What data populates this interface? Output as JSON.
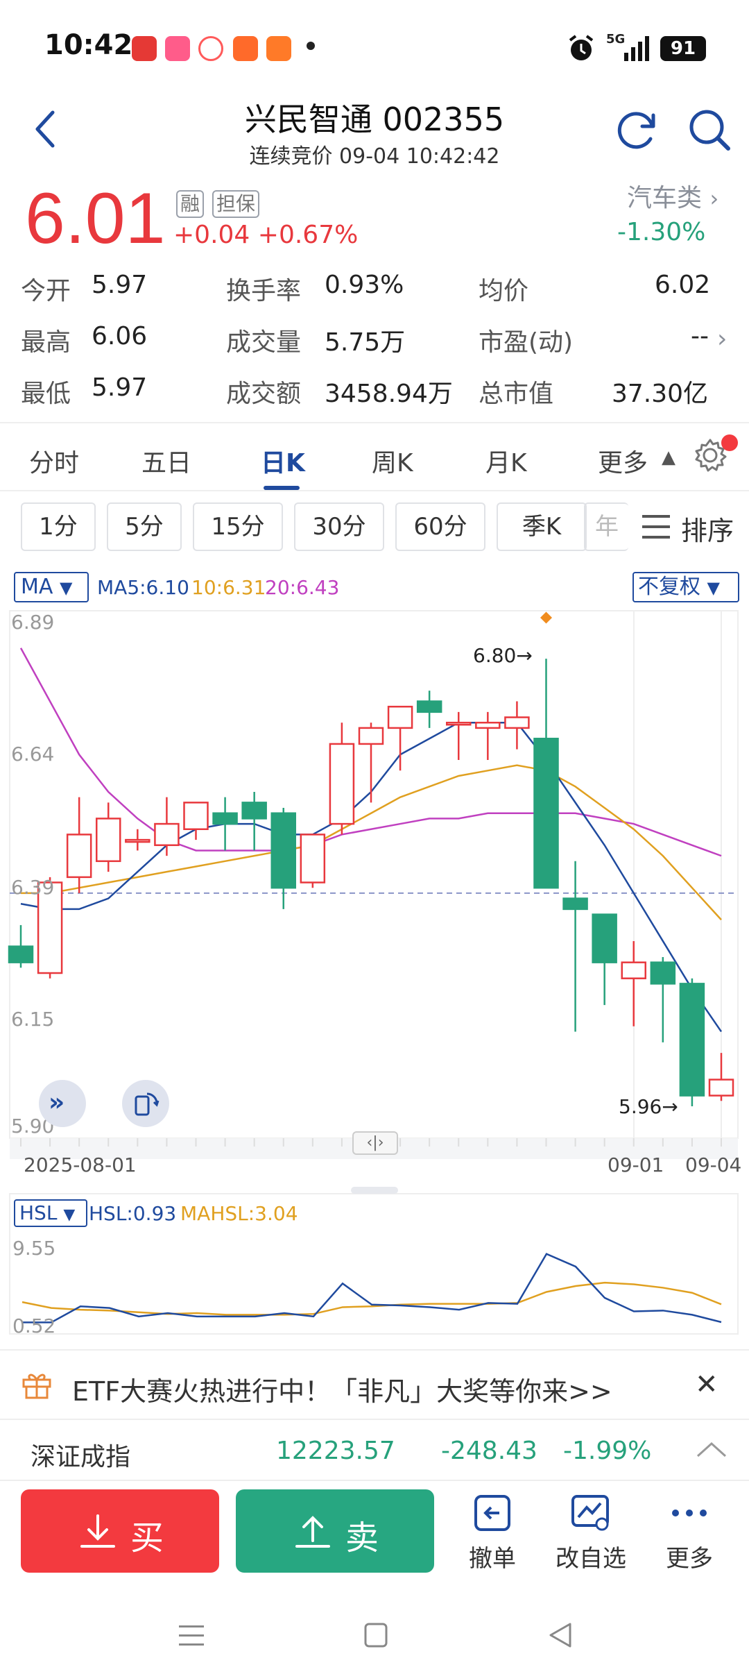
{
  "status": {
    "time": "10:42",
    "network": "5G",
    "battery": "91"
  },
  "header": {
    "title": "兴民智通 002355",
    "subtitle": "连续竞价 09-04 10:42:42"
  },
  "quote": {
    "price": "6.01",
    "tag_margin": "融",
    "tag_collateral": "担保",
    "change": "+0.04",
    "change_pct": "+0.67%",
    "sector_name": "汽车类",
    "sector_change": "-1.30%"
  },
  "stats": [
    {
      "label": "今开",
      "value": "5.97"
    },
    {
      "label": "换手率",
      "value": "0.93%"
    },
    {
      "label": "均价",
      "value": "6.02"
    },
    {
      "label": "最高",
      "value": "6.06"
    },
    {
      "label": "成交量",
      "value": "5.75万"
    },
    {
      "label": "市盈(动)",
      "value": "--"
    },
    {
      "label": "最低",
      "value": "5.97"
    },
    {
      "label": "成交额",
      "value": "3458.94万"
    },
    {
      "label": "总市值",
      "value": "37.30亿"
    }
  ],
  "tabs": [
    "分时",
    "五日",
    "日K",
    "周K",
    "月K",
    "更多"
  ],
  "intervals": [
    "1分",
    "5分",
    "15分",
    "30分",
    "60分",
    "季K",
    "年"
  ],
  "sort_label": "排序",
  "indicator": {
    "main": "MA",
    "ma5": "MA5:6.10",
    "ma10": "10:6.31",
    "ma20": "20:6.43",
    "adjust": "不复权",
    "sub": "HSL",
    "hsl": "HSL:0.93",
    "mahsl": "MAHSL:3.04"
  },
  "chart_data": {
    "type": "candlestick",
    "y_ticks": [
      "6.89",
      "6.64",
      "6.39",
      "6.15",
      "5.90"
    ],
    "ylim": [
      5.9,
      6.89
    ],
    "x_labels": [
      "2025-08-01",
      "09-01",
      "09-04"
    ],
    "high_marker": "6.80→",
    "low_marker": "5.96→",
    "candles": [
      {
        "o": 6.26,
        "h": 6.3,
        "l": 6.22,
        "c": 6.23
      },
      {
        "o": 6.21,
        "h": 6.39,
        "l": 6.2,
        "c": 6.38
      },
      {
        "o": 6.39,
        "h": 6.54,
        "l": 6.36,
        "c": 6.47
      },
      {
        "o": 6.42,
        "h": 6.53,
        "l": 6.4,
        "c": 6.5
      },
      {
        "o": 6.46,
        "h": 6.48,
        "l": 6.44,
        "c": 6.46
      },
      {
        "o": 6.45,
        "h": 6.54,
        "l": 6.43,
        "c": 6.49
      },
      {
        "o": 6.48,
        "h": 6.53,
        "l": 6.46,
        "c": 6.53
      },
      {
        "o": 6.51,
        "h": 6.54,
        "l": 6.44,
        "c": 6.49
      },
      {
        "o": 6.53,
        "h": 6.55,
        "l": 6.44,
        "c": 6.5
      },
      {
        "o": 6.51,
        "h": 6.52,
        "l": 6.33,
        "c": 6.37
      },
      {
        "o": 6.38,
        "h": 6.47,
        "l": 6.37,
        "c": 6.47
      },
      {
        "o": 6.49,
        "h": 6.68,
        "l": 6.47,
        "c": 6.64
      },
      {
        "o": 6.64,
        "h": 6.68,
        "l": 6.53,
        "c": 6.67
      },
      {
        "o": 6.67,
        "h": 6.71,
        "l": 6.59,
        "c": 6.71
      },
      {
        "o": 6.72,
        "h": 6.74,
        "l": 6.67,
        "c": 6.7
      },
      {
        "o": 6.68,
        "h": 6.7,
        "l": 6.61,
        "c": 6.68
      },
      {
        "o": 6.67,
        "h": 6.7,
        "l": 6.61,
        "c": 6.68
      },
      {
        "o": 6.67,
        "h": 6.72,
        "l": 6.63,
        "c": 6.69
      },
      {
        "o": 6.65,
        "h": 6.8,
        "l": 6.37,
        "c": 6.37
      },
      {
        "o": 6.35,
        "h": 6.42,
        "l": 6.1,
        "c": 6.33
      },
      {
        "o": 6.32,
        "h": 6.32,
        "l": 6.15,
        "c": 6.23
      },
      {
        "o": 6.2,
        "h": 6.27,
        "l": 6.11,
        "c": 6.23
      },
      {
        "o": 6.23,
        "h": 6.24,
        "l": 6.08,
        "c": 6.19
      },
      {
        "o": 6.19,
        "h": 6.2,
        "l": 5.96,
        "c": 5.98
      },
      {
        "o": 5.98,
        "h": 6.06,
        "l": 5.97,
        "c": 6.01
      }
    ],
    "ma5": [
      6.34,
      6.33,
      6.33,
      6.35,
      6.4,
      6.45,
      6.48,
      6.49,
      6.49,
      6.47,
      6.47,
      6.5,
      6.55,
      6.62,
      6.65,
      6.68,
      6.68,
      6.68,
      6.61,
      6.53,
      6.45,
      6.36,
      6.27,
      6.18,
      6.1
    ],
    "ma10": [
      6.36,
      6.36,
      6.37,
      6.38,
      6.39,
      6.4,
      6.41,
      6.42,
      6.43,
      6.44,
      6.45,
      6.48,
      6.51,
      6.54,
      6.56,
      6.58,
      6.59,
      6.6,
      6.59,
      6.56,
      6.52,
      6.48,
      6.43,
      6.37,
      6.31
    ],
    "ma20": [
      6.82,
      6.72,
      6.62,
      6.55,
      6.5,
      6.46,
      6.44,
      6.44,
      6.44,
      6.44,
      6.45,
      6.47,
      6.48,
      6.49,
      6.5,
      6.5,
      6.51,
      6.51,
      6.51,
      6.51,
      6.5,
      6.49,
      6.47,
      6.45,
      6.43
    ],
    "hsl_ticks": [
      "9.55",
      "0.52"
    ],
    "hsl": [
      0.9,
      0.9,
      2.8,
      2.6,
      1.6,
      2.0,
      1.6,
      1.6,
      1.6,
      2.0,
      1.6,
      5.5,
      3.0,
      2.9,
      2.7,
      2.4,
      3.2,
      3.1,
      9.0,
      7.5,
      3.8,
      2.2,
      2.3,
      1.8,
      0.93
    ],
    "mahsl": [
      3.3,
      2.6,
      2.4,
      2.3,
      2.1,
      1.9,
      2.0,
      1.8,
      1.8,
      1.8,
      1.9,
      2.7,
      2.8,
      3.0,
      3.1,
      3.1,
      3.1,
      3.2,
      4.5,
      5.2,
      5.6,
      5.4,
      5.0,
      4.4,
      3.04
    ]
  },
  "promo": {
    "text": "ETF大赛火热进行中！「非凡」大奖等你来>>"
  },
  "index": {
    "name": "深证成指",
    "value": "12223.57",
    "change": "-248.43",
    "change_pct": "-1.99%"
  },
  "actions": {
    "buy": "买",
    "sell": "卖",
    "cancel": "撤单",
    "watchlist": "改自选",
    "more": "更多"
  },
  "colors": {
    "up": "#e8383d",
    "down": "#26a17b",
    "ma5": "#1f4a9e",
    "ma10": "#e0a020",
    "ma20": "#c040c0",
    "accent": "#1f4a9e"
  }
}
